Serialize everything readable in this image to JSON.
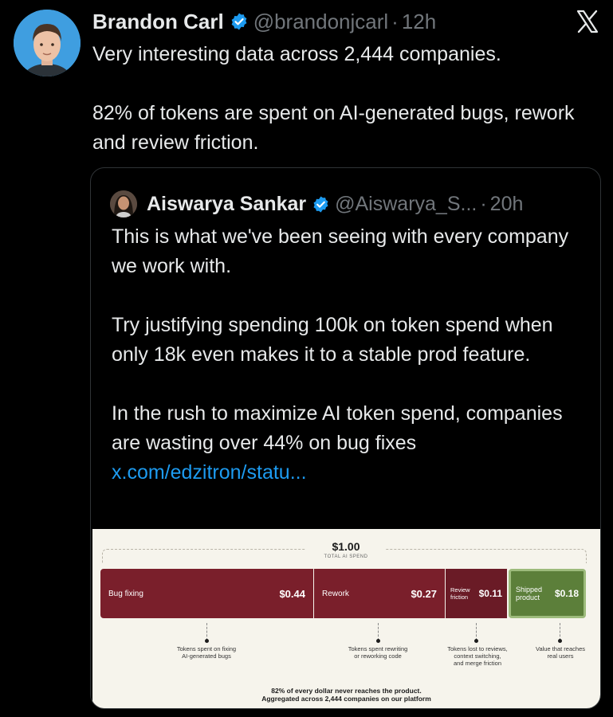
{
  "tweet": {
    "author_name": "Brandon Carl",
    "handle": "@brandonjcarl",
    "separator": "·",
    "time": "12h",
    "text": "Very interesting data across 2,444 companies.\n\n82% of tokens are spent on AI-generated bugs, rework and review friction."
  },
  "quote": {
    "author_name": "Aiswarya Sankar",
    "handle": "@Aiswarya_S...",
    "separator": "·",
    "time": "20h",
    "text": "This is what we've been seeing with every company we work with.\n\nTry justifying spending 100k on token spend when only 18k even makes it to a stable prod feature.\n\nIn the rush to maximize AI token spend, companies are wasting over 44% on bug fixes ",
    "link": "x.com/edzitron/statu..."
  },
  "infographic": {
    "total_value": "$1.00",
    "total_label": "TOTAL AI SPEND",
    "segments": [
      {
        "label": "Bug fixing",
        "value": "$0.44",
        "amount": 0.44,
        "color": "#7a1f2b"
      },
      {
        "label": "Rework",
        "value": "$0.27",
        "amount": 0.27,
        "color": "#7a1f2b"
      },
      {
        "label_line1": "Review",
        "label_line2": "friction",
        "value": "$0.11",
        "amount": 0.11,
        "color": "#6a1b26"
      },
      {
        "label_line1": "Shipped",
        "label_line2": "product",
        "value": "$0.18",
        "amount": 0.18,
        "color": "#5c7f3a"
      }
    ],
    "notes": [
      {
        "line1": "Tokens spent on fixing",
        "line2": "AI-generated bugs"
      },
      {
        "line1": "Tokens spent rewriting",
        "line2": "or reworking code"
      },
      {
        "line1": "Tokens lost to reviews,",
        "line2": "context switching,",
        "line3": "and merge friction"
      },
      {
        "line1": "Value that reaches",
        "line2": "real users"
      }
    ],
    "footer_line1": "82% of every dollar never reaches the product.",
    "footer_line2": "Aggregated across 2,444 companies on our platform"
  },
  "icons": {
    "verified": "verified-badge-icon",
    "x_logo": "x-logo-icon"
  },
  "colors": {
    "background": "#000000",
    "text": "#e7e9ea",
    "muted": "#71767b",
    "link": "#1d9bf0",
    "verified": "#1d9bf0"
  }
}
